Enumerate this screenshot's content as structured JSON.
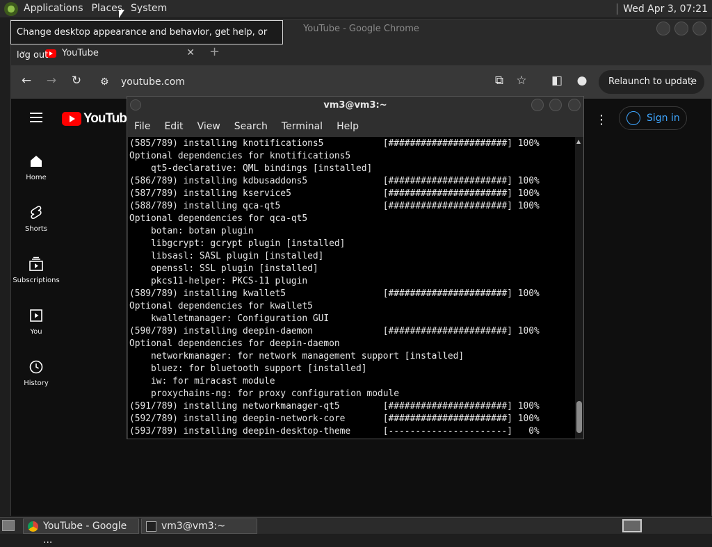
{
  "top_panel": {
    "menus": [
      "Applications",
      "Places",
      "System"
    ],
    "clock": "Wed Apr  3, 07:21"
  },
  "tooltip": "Change desktop appearance and behavior, get help, or log out",
  "chrome": {
    "window_title": "YouTube - Google Chrome",
    "tab_label": "YouTube",
    "tab_close": "✕",
    "new_tab": "+",
    "url": "youtube.com",
    "relaunch_label": "Relaunch to update",
    "relaunch_more": "⋮"
  },
  "youtube": {
    "logo_text": "YouTube",
    "nav": [
      {
        "label": "Home",
        "icon": "home-icon"
      },
      {
        "label": "Shorts",
        "icon": "shorts-icon"
      },
      {
        "label": "Subscriptions",
        "icon": "subscriptions-icon"
      },
      {
        "label": "You",
        "icon": "you-icon"
      },
      {
        "label": "History",
        "icon": "history-icon"
      }
    ],
    "sign_in": "Sign in"
  },
  "terminal": {
    "title": "vm3@vm3:~",
    "menus": [
      "File",
      "Edit",
      "View",
      "Search",
      "Terminal",
      "Help"
    ],
    "lines": [
      "(585/789) installing knotifications5           [######################] 100%",
      "Optional dependencies for knotifications5",
      "    qt5-declarative: QML bindings [installed]",
      "(586/789) installing kdbusaddons5              [######################] 100%",
      "(587/789) installing kservice5                 [######################] 100%",
      "(588/789) installing qca-qt5                   [######################] 100%",
      "Optional dependencies for qca-qt5",
      "    botan: botan plugin",
      "    libgcrypt: gcrypt plugin [installed]",
      "    libsasl: SASL plugin [installed]",
      "    openssl: SSL plugin [installed]",
      "    pkcs11-helper: PKCS-11 plugin",
      "(589/789) installing kwallet5                  [######################] 100%",
      "Optional dependencies for kwallet5",
      "    kwalletmanager: Configuration GUI",
      "(590/789) installing deepin-daemon             [######################] 100%",
      "Optional dependencies for deepin-daemon",
      "    networkmanager: for network management support [installed]",
      "    bluez: for bluetooth support [installed]",
      "    iw: for miracast module",
      "    proxychains-ng: for proxy configuration module",
      "(591/789) installing networkmanager-qt5        [######################] 100%",
      "(592/789) installing deepin-network-core       [######################] 100%",
      "(593/789) installing deepin-desktop-theme      [----------------------]   0%"
    ]
  },
  "taskbar": {
    "tasks": [
      "YouTube - Google ...",
      "vm3@vm3:~"
    ]
  }
}
